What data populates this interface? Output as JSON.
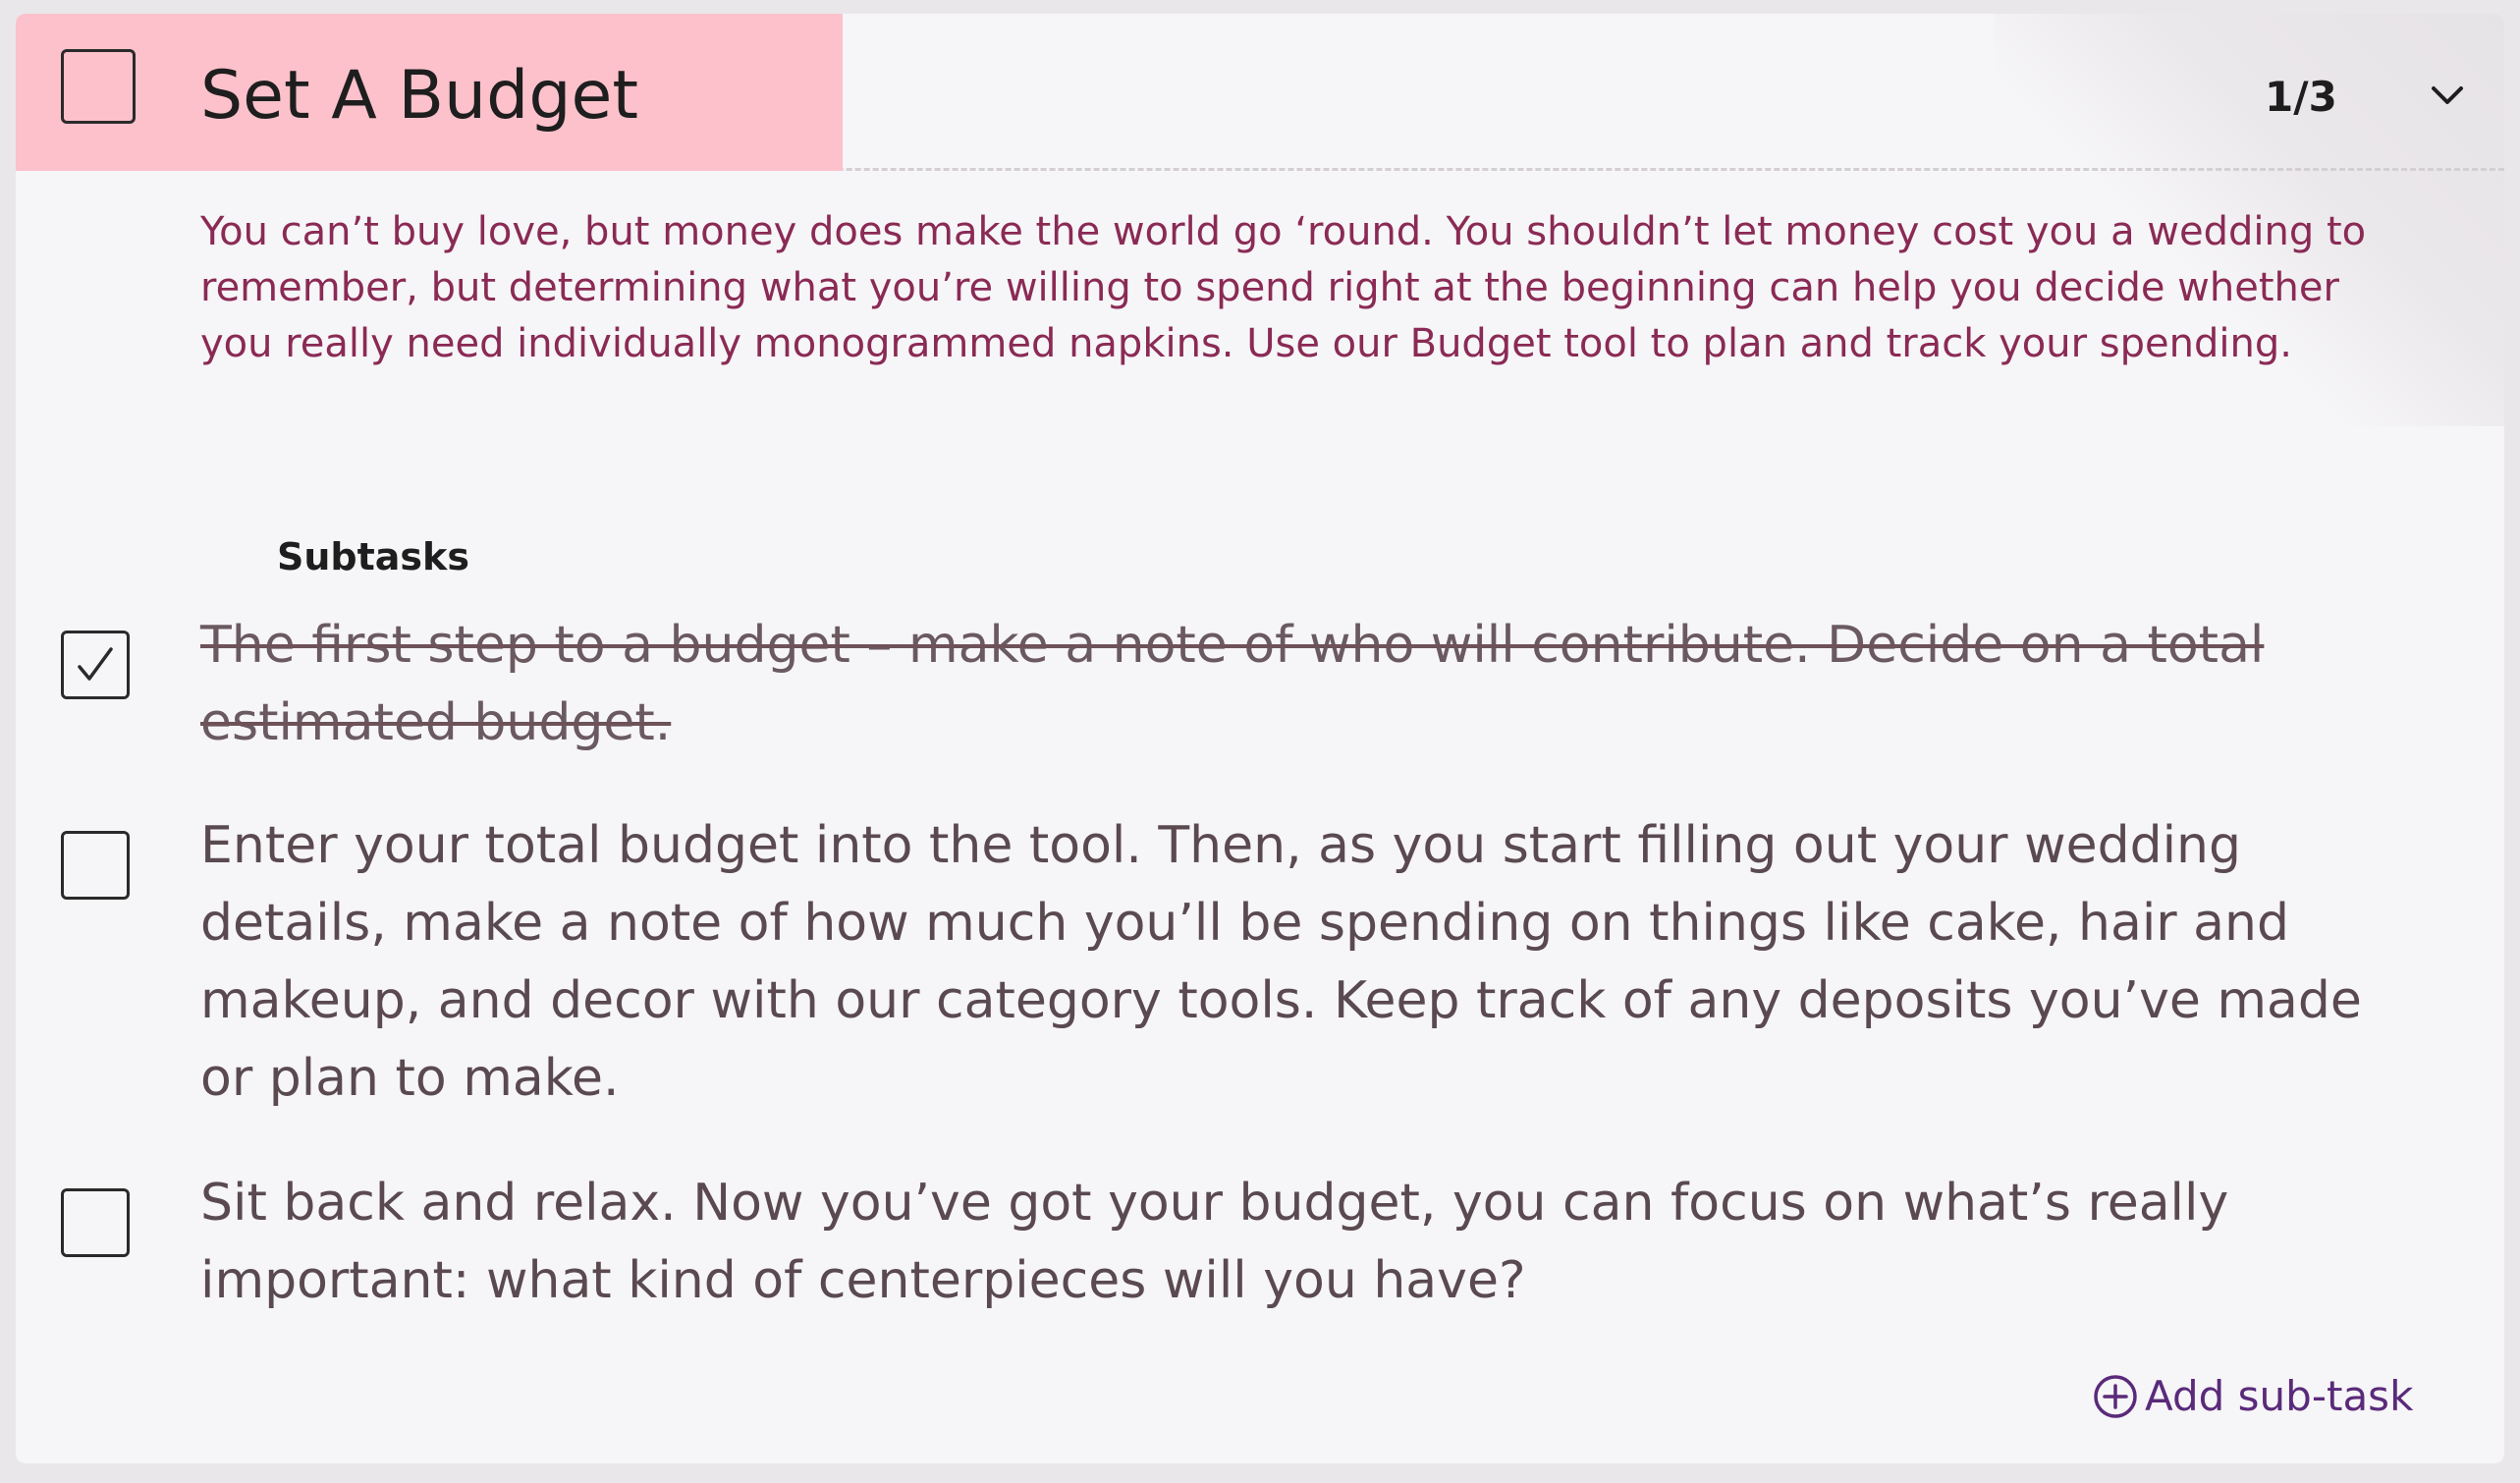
{
  "task": {
    "title": "Set A Budget",
    "progress": "1/3",
    "checked": false,
    "description": "You can’t buy love, but money does make the world go ‘round. You shouldn’t let money cost you a wedding to remember, but determining what you’re willing to spend right at the beginning can help you decide whether you really need individually monogrammed napkins. Use our Budget tool to plan and track your spending."
  },
  "subtasks": {
    "heading": "Subtasks",
    "items": [
      {
        "text": "The first step to a budget – make a note of who will contribute. Decide on a total estimated budget.",
        "checked": true
      },
      {
        "text": "Enter your total budget into the tool. Then, as you start filling out your wedding details, make a note of how much you’ll be spending on things like cake, hair and makeup, and decor with our category tools. Keep track of any deposits you’ve made or plan to make.",
        "checked": false
      },
      {
        "text": "Sit back and relax. Now you’ve got your budget, you can focus on what’s really important: what kind of centerpieces will you have?",
        "checked": false
      }
    ],
    "add_label": "Add sub-task"
  },
  "colors": {
    "header_highlight": "#fcc1cb",
    "description_text": "#8a2a55",
    "link_accent": "#5a2a7a",
    "card_background": "#f6f5f7"
  },
  "icons": {
    "expand": "chevron-down-icon",
    "add": "plus-circle-icon",
    "check": "checkmark-icon"
  }
}
